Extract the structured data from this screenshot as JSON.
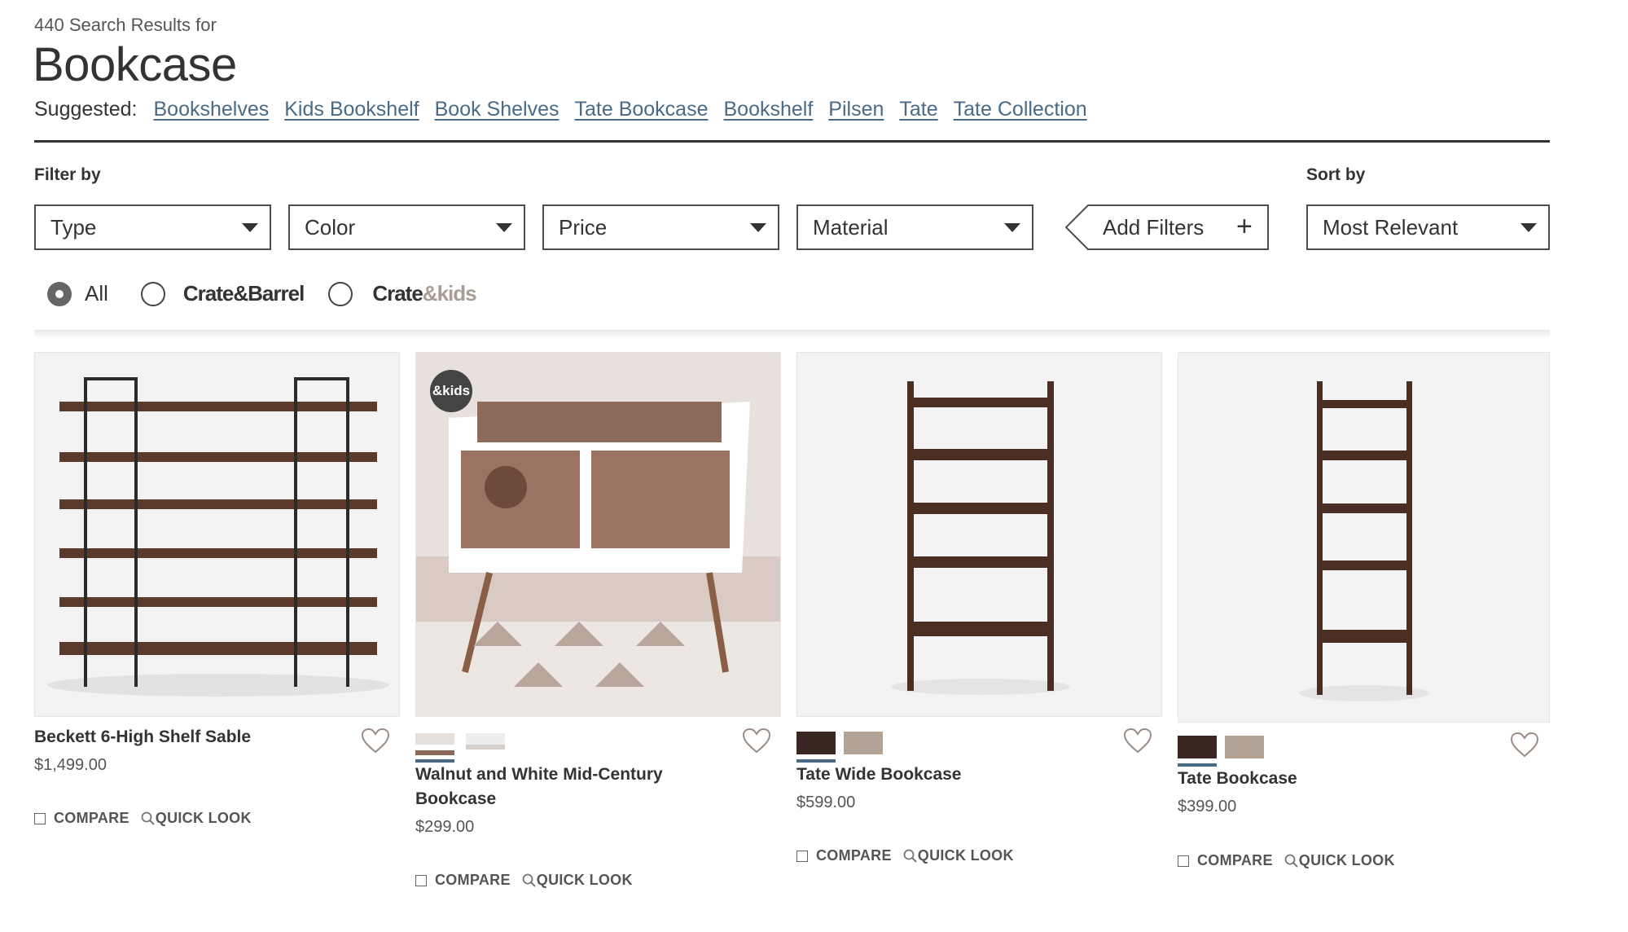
{
  "header": {
    "results_count": "440 Search Results for",
    "title": "Bookcase",
    "suggested_label": "Suggested:",
    "suggestions": [
      "Bookshelves",
      "Kids Bookshelf",
      "Book Shelves",
      "Tate Bookcase",
      "Bookshelf",
      "Pilsen",
      "Tate",
      "Tate Collection"
    ]
  },
  "filters": {
    "filter_by_label": "Filter by",
    "sort_by_label": "Sort by",
    "dropdowns": [
      "Type",
      "Color",
      "Price",
      "Material"
    ],
    "add_filters": "Add Filters",
    "sort_value": "Most Relevant"
  },
  "brands": {
    "all": "All",
    "crate_barrel": "Crate&Barrel",
    "crate_kids_a": "Crate",
    "crate_kids_b": "&kids",
    "selected": "All"
  },
  "products": [
    {
      "name": "Beckett 6-High Shelf Sable",
      "price": "$1,499.00",
      "compare": "COMPARE",
      "quick_look": "QUICK LOOK",
      "swatches": []
    },
    {
      "name": "Walnut and White Mid-Century Bookcase",
      "name_line1": "Walnut and White Mid-Century",
      "name_line2": "Bookcase",
      "price": "$299.00",
      "compare": "COMPARE",
      "quick_look": "QUICK LOOK",
      "badge": "&kids",
      "swatches": [
        "#8a6a58",
        "#e6e0dc"
      ]
    },
    {
      "name": "Tate Wide Bookcase",
      "price": "$599.00",
      "compare": "COMPARE",
      "quick_look": "QUICK LOOK",
      "swatches": [
        "#3a2620",
        "#b3a394"
      ]
    },
    {
      "name": "Tate Bookcase",
      "price": "$399.00",
      "compare": "COMPARE",
      "quick_look": "QUICK LOOK",
      "swatches": [
        "#3a2620",
        "#b3a394"
      ]
    }
  ],
  "colors": {
    "link": "#4a6a86",
    "text": "#333333",
    "wood_dark": "#4a2e24",
    "wood_mid": "#6b4636"
  }
}
